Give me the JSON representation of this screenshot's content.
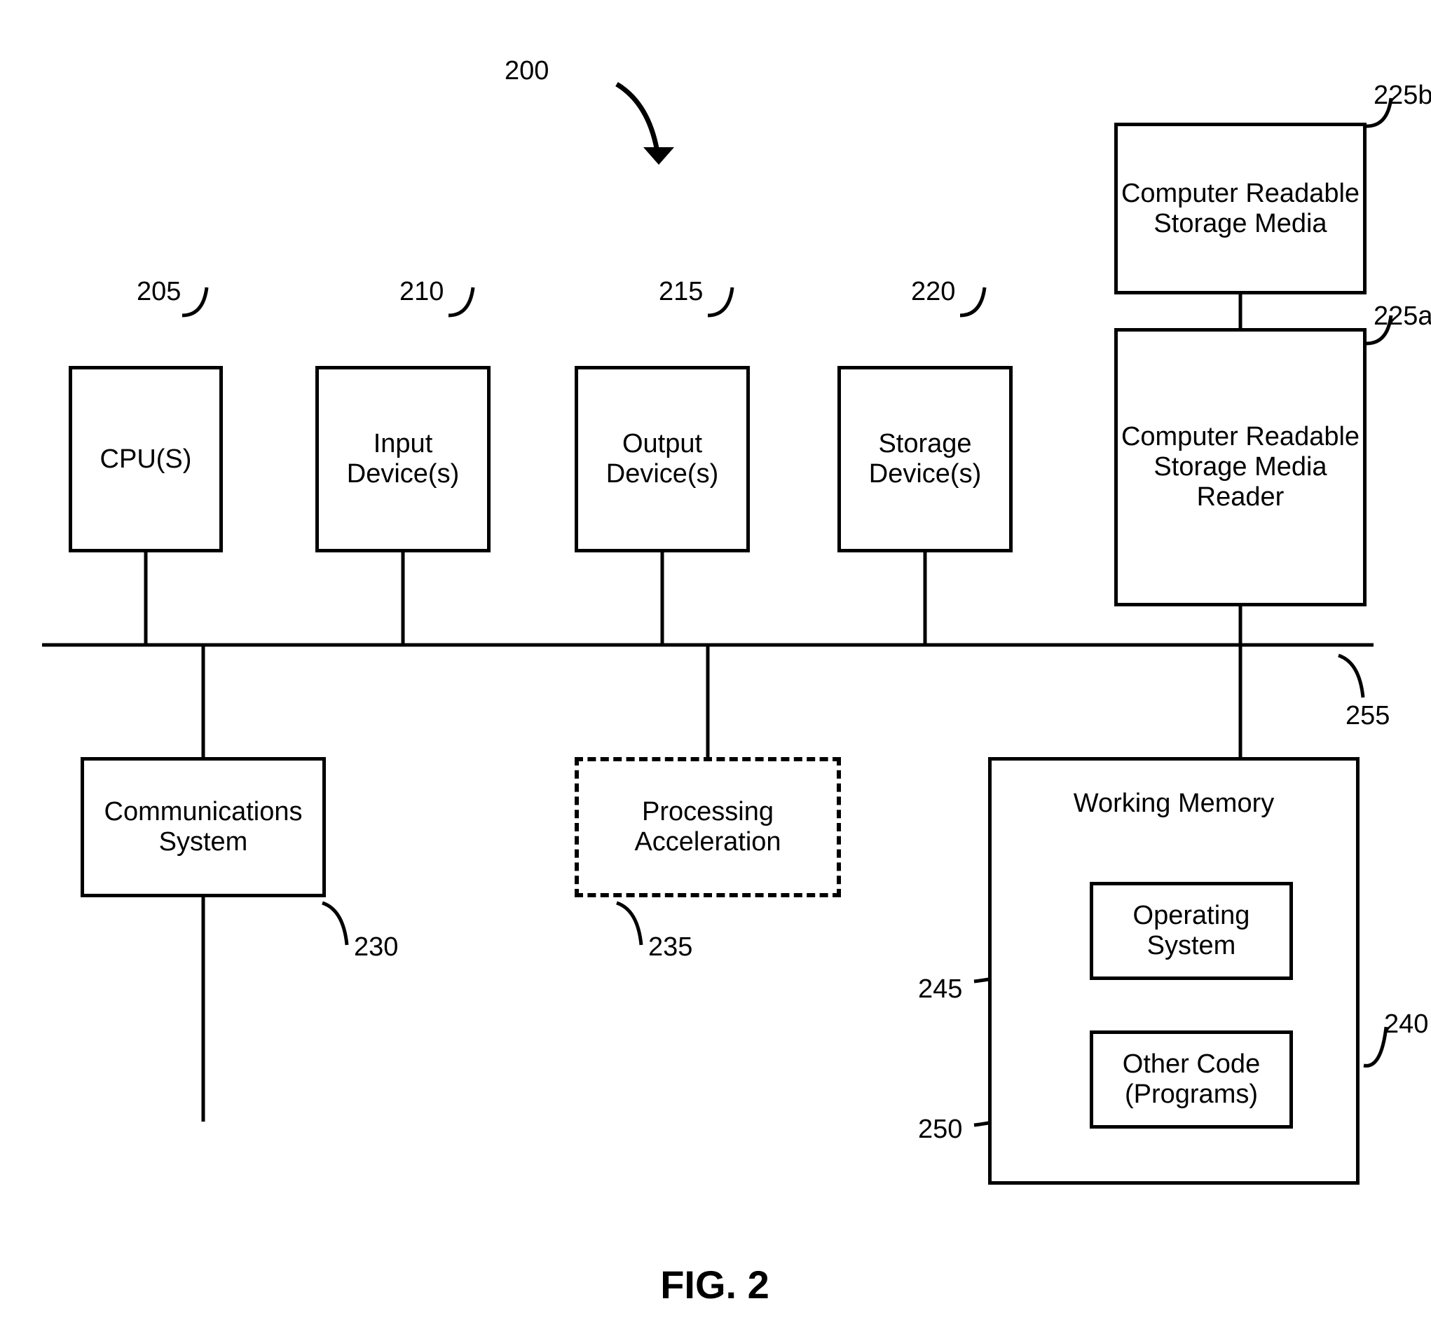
{
  "figure": {
    "title": "FIG. 2",
    "main_ref": "200"
  },
  "boxes": {
    "cpu": {
      "label": "CPU(S)",
      "ref": "205"
    },
    "input": {
      "label": "Input Device(s)",
      "ref": "210"
    },
    "output": {
      "label": "Output Device(s)",
      "ref": "215"
    },
    "storage": {
      "label": "Storage Device(s)",
      "ref": "220"
    },
    "crsm": {
      "label": "Computer Readable Storage Media",
      "ref": "225b"
    },
    "crsmr": {
      "label": "Computer Readable Storage Media Reader",
      "ref": "225a"
    },
    "comm": {
      "label": "Communications System",
      "ref": "230"
    },
    "accel": {
      "label": "Processing Acceleration",
      "ref": "235"
    },
    "wm": {
      "label": "Working Memory",
      "ref": "240"
    },
    "os": {
      "label": "Operating System",
      "ref": "245"
    },
    "other": {
      "label": "Other Code (Programs)",
      "ref": "250"
    }
  },
  "bus_ref": "255"
}
